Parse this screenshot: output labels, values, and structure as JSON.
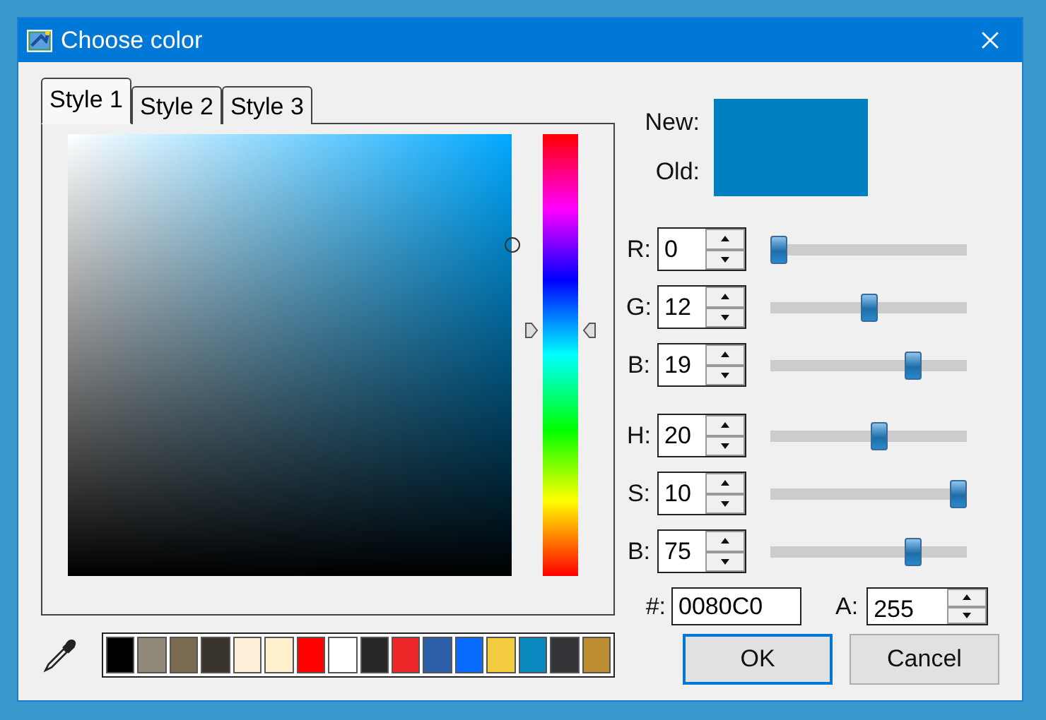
{
  "window": {
    "title": "Choose color"
  },
  "tabs": [
    {
      "label": "Style 1",
      "selected": true
    },
    {
      "label": "Style 2",
      "selected": false
    },
    {
      "label": "Style 3",
      "selected": false
    }
  ],
  "preview": [
    {
      "label": "New:",
      "color": "#0080c0"
    },
    {
      "label": "Old:",
      "color": "#0080c0"
    }
  ],
  "channels": [
    {
      "kind": "rgb",
      "label": "R:",
      "value": "0",
      "level": 0
    },
    {
      "kind": "rgb",
      "label": "G:",
      "value": "12",
      "level": 0.5
    },
    {
      "kind": "rgb",
      "label": "B:",
      "value": "19",
      "level": 0.75
    },
    {
      "kind": "hsb",
      "label": "H:",
      "value": "20",
      "level": 0.556
    },
    {
      "kind": "hsb",
      "label": "S:",
      "value": "10",
      "level": 1
    },
    {
      "kind": "hsb",
      "label": "B:",
      "value": "75",
      "level": 0.75
    }
  ],
  "swatches": [
    {
      "color": "#000000"
    },
    {
      "color": "#908878"
    },
    {
      "color": "#7a6c50"
    },
    {
      "color": "#38342c"
    },
    {
      "color": "#fdf0d8"
    },
    {
      "color": "#fdf0cc"
    },
    {
      "color": "#ff0000"
    },
    {
      "color": "#ffffff"
    },
    {
      "color": "#262626"
    },
    {
      "color": "#ee2828"
    },
    {
      "color": "#2a5ea8"
    },
    {
      "color": "#0a6cff"
    },
    {
      "color": "#f4cc40"
    },
    {
      "color": "#0a88c0"
    },
    {
      "color": "#323438"
    },
    {
      "color": "#bc8c30"
    }
  ],
  "hex": {
    "label": "#:",
    "value": "0080C0"
  },
  "alpha": {
    "label": "A:",
    "value": "255"
  },
  "buttons": [
    {
      "label": "OK",
      "default": true
    },
    {
      "label": "Cancel",
      "default": false
    }
  ]
}
